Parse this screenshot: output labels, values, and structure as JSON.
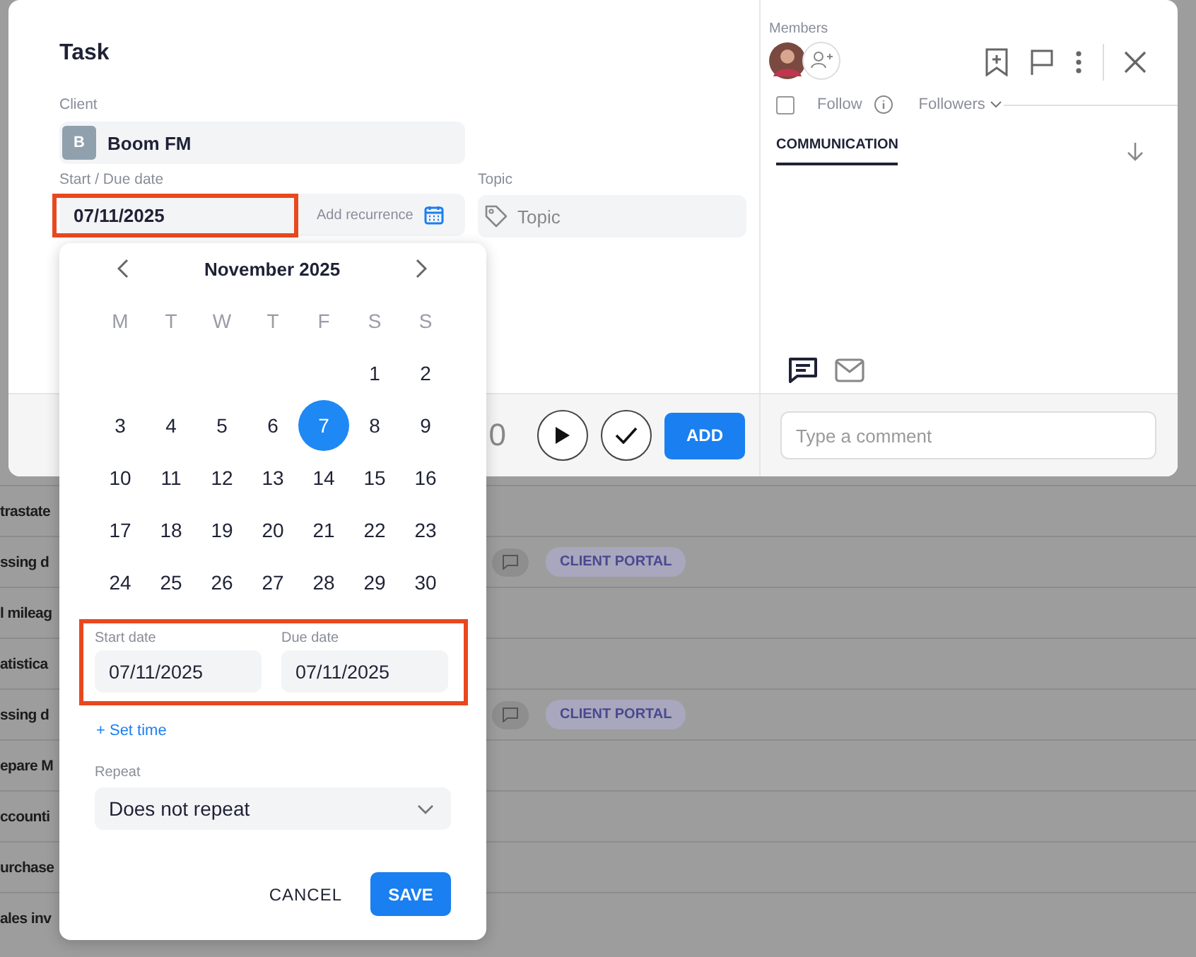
{
  "background_rows": [
    {
      "title": "trastate",
      "comment": false,
      "badge": null
    },
    {
      "title": "ssing d",
      "comment": true,
      "badge": "CLIENT PORTAL"
    },
    {
      "title": "l mileag",
      "comment": false,
      "badge": null
    },
    {
      "title": "atistica",
      "comment": false,
      "badge": null
    },
    {
      "title": "ssing d",
      "comment": true,
      "badge": "CLIENT PORTAL"
    },
    {
      "title": "epare M",
      "comment": false,
      "badge": null
    },
    {
      "title": "ccounti",
      "comment": false,
      "badge": null
    },
    {
      "title": "urchase",
      "comment": false,
      "badge": null
    },
    {
      "title": "ales inv",
      "comment": false,
      "badge": null
    }
  ],
  "task": {
    "title": "Task",
    "client_label": "Client",
    "client": {
      "initial": "B",
      "name": "Boom FM"
    },
    "date_label": "Start / Due date",
    "date_value": "07/11/2025",
    "date_highlighted": true,
    "recurrence_link": "Add recurrence",
    "topic_label": "Topic",
    "topic_placeholder": "Topic"
  },
  "footer": {
    "timer_fragment": "0",
    "add_button": "ADD"
  },
  "side": {
    "members_label": "Members",
    "follow": {
      "label": "Follow",
      "checked": false
    },
    "followers_label": "Followers",
    "tabs": [
      {
        "label": "COMMUNICATION",
        "selected": true
      }
    ],
    "comment_placeholder": "Type a comment"
  },
  "date_picker": {
    "month": "November 2025",
    "weekdays": [
      "M",
      "T",
      "W",
      "T",
      "F",
      "S",
      "S"
    ],
    "weeks": [
      [
        {
          "day": "1",
          "selected": false
        },
        {
          "day": "2",
          "selected": false
        }
      ],
      [
        {
          "day": "3",
          "selected": false
        },
        {
          "day": "4",
          "selected": false
        },
        {
          "day": "5",
          "selected": false
        },
        {
          "day": "6",
          "selected": false
        },
        {
          "day": "7",
          "selected": true
        },
        {
          "day": "8",
          "selected": false
        },
        {
          "day": "9",
          "selected": false
        }
      ],
      [
        {
          "day": "10",
          "selected": false
        },
        {
          "day": "11",
          "selected": false
        },
        {
          "day": "12",
          "selected": false
        },
        {
          "day": "13",
          "selected": false
        },
        {
          "day": "14",
          "selected": false
        },
        {
          "day": "15",
          "selected": false
        },
        {
          "day": "16",
          "selected": false
        }
      ],
      [
        {
          "day": "17",
          "selected": false
        },
        {
          "day": "18",
          "selected": false
        },
        {
          "day": "19",
          "selected": false
        },
        {
          "day": "20",
          "selected": false
        },
        {
          "day": "21",
          "selected": false
        },
        {
          "day": "22",
          "selected": false
        },
        {
          "day": "23",
          "selected": false
        }
      ],
      [
        {
          "day": "24",
          "selected": false
        },
        {
          "day": "25",
          "selected": false
        },
        {
          "day": "26",
          "selected": false
        },
        {
          "day": "27",
          "selected": false
        },
        {
          "day": "28",
          "selected": false
        },
        {
          "day": "29",
          "selected": false
        },
        {
          "day": "30",
          "selected": false
        }
      ]
    ],
    "range_highlighted": true,
    "start_label": "Start date",
    "start_value": "07/11/2025",
    "due_label": "Due date",
    "due_value": "07/11/2025",
    "set_time": "+ Set time",
    "repeat_label": "Repeat",
    "repeat_value": "Does not repeat",
    "cancel": "CANCEL",
    "save": "SAVE"
  }
}
